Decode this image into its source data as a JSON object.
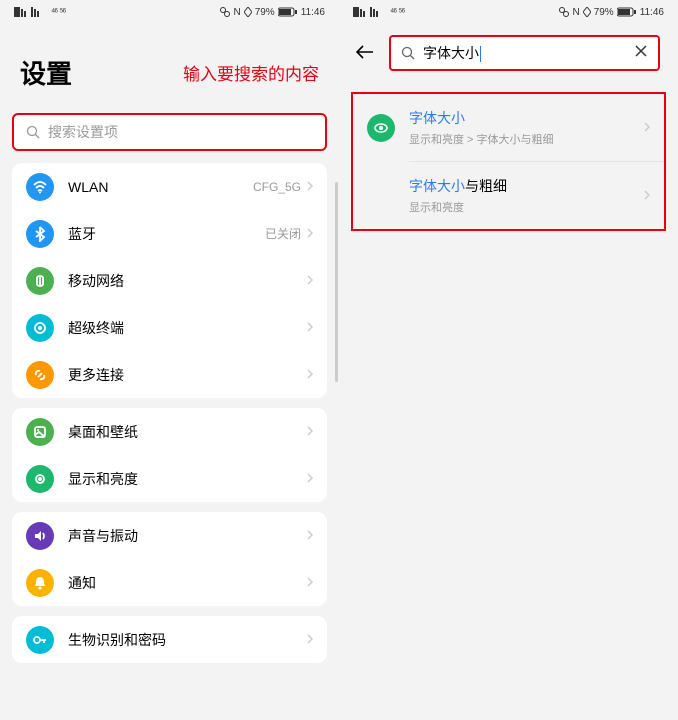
{
  "status": {
    "signal_text": "ᴴᴰ ⁴⁶ ⁵⁶",
    "right_text": "79%",
    "time": "11:46"
  },
  "left": {
    "title": "设置",
    "annotation": "输入要搜索的内容",
    "search_placeholder": "搜索设置项",
    "groups": [
      [
        {
          "icon": "wifi",
          "color": "#2196f3",
          "label": "WLAN",
          "value": "CFG_5G"
        },
        {
          "icon": "bt",
          "color": "#2196f3",
          "label": "蓝牙",
          "value": "已关闭"
        },
        {
          "icon": "mobile",
          "color": "#4caf50",
          "label": "移动网络",
          "value": ""
        },
        {
          "icon": "super",
          "color": "#00bcd4",
          "label": "超级终端",
          "value": ""
        },
        {
          "icon": "link",
          "color": "#ff9800",
          "label": "更多连接",
          "value": ""
        }
      ],
      [
        {
          "icon": "wallpaper",
          "color": "#4caf50",
          "label": "桌面和壁纸",
          "value": ""
        },
        {
          "icon": "display",
          "color": "#1db86e",
          "label": "显示和亮度",
          "value": ""
        }
      ],
      [
        {
          "icon": "sound",
          "color": "#673ab7",
          "label": "声音与振动",
          "value": ""
        },
        {
          "icon": "bell",
          "color": "#ffb300",
          "label": "通知",
          "value": ""
        }
      ],
      [
        {
          "icon": "key",
          "color": "#00bcd4",
          "label": "生物识别和密码",
          "value": ""
        }
      ]
    ]
  },
  "right": {
    "search_value": "字体大小",
    "results": [
      {
        "title_hl": "字体大小",
        "title_rest": "",
        "sub": "显示和亮度 > 字体大小与粗细",
        "show_icon": true
      },
      {
        "title_hl": "字体大小",
        "title_rest": "与粗细",
        "sub": "显示和亮度",
        "show_icon": false
      }
    ]
  }
}
